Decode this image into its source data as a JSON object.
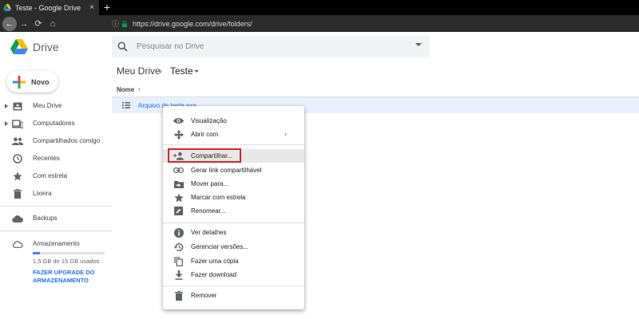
{
  "browser": {
    "tab_title": "Teste - Google Drive",
    "tab_close": "×",
    "new_tab": "+",
    "url": "https://drive.google.com/drive/folders/",
    "nav": {
      "back": "←",
      "forward": "→",
      "refresh": "⟳",
      "home": "⌂"
    }
  },
  "header": {
    "app_name": "Drive",
    "search_placeholder": "Pesquisar no Drive"
  },
  "sidebar": {
    "new_button": "Novo",
    "items": [
      {
        "label": "Meu Drive",
        "icon": "my-drive-icon",
        "expandable": true
      },
      {
        "label": "Computadores",
        "icon": "computer-icon",
        "expandable": true
      },
      {
        "label": "Compartilhados comigo",
        "icon": "shared-people-icon",
        "expandable": false
      },
      {
        "label": "Recentes",
        "icon": "clock-icon",
        "expandable": false
      },
      {
        "label": "Com estrela",
        "icon": "star-icon",
        "expandable": false
      },
      {
        "label": "Lixeira",
        "icon": "trash-icon",
        "expandable": false
      }
    ],
    "backups": {
      "label": "Backups",
      "icon": "cloud-icon"
    },
    "storage": {
      "label": "Armazenamento",
      "usage_text": "1,5 GB de 15 GB usados",
      "used_fraction": 0.1,
      "upgrade_link": "FAZER UPGRADE DO ARMAZENAMENTO"
    }
  },
  "main": {
    "breadcrumb": {
      "root": "Meu Drive",
      "separator": "›",
      "current": "Teste"
    },
    "column_header": "Nome",
    "sort_arrow": "↑",
    "files": [
      {
        "name": "Arquivo de teste.exe"
      }
    ]
  },
  "context_menu": {
    "groups": [
      [
        {
          "label": "Visualização",
          "icon": "eye-icon"
        },
        {
          "label": "Abrir com",
          "icon": "open-with-icon",
          "submenu": "›"
        }
      ],
      [
        {
          "label": "Compartilhar...",
          "icon": "share-person-icon",
          "highlighted": true
        },
        {
          "label": "Gerar link compartilhável",
          "icon": "link-icon"
        },
        {
          "label": "Mover para...",
          "icon": "move-folder-icon"
        },
        {
          "label": "Marcar com estrela",
          "icon": "star-icon"
        },
        {
          "label": "Renomear...",
          "icon": "rename-icon"
        }
      ],
      [
        {
          "label": "Ver detalhes",
          "icon": "info-icon"
        },
        {
          "label": "Gerenciar versões...",
          "icon": "history-icon"
        },
        {
          "label": "Fazer uma cópia",
          "icon": "copy-icon"
        },
        {
          "label": "Fazer download",
          "icon": "download-icon"
        }
      ],
      [
        {
          "label": "Remover",
          "icon": "trash-icon"
        }
      ]
    ]
  },
  "colors": {
    "accent_blue": "#1a73e8",
    "highlight_outline": "#d8232a",
    "selected_row": "#e8f0fe"
  }
}
